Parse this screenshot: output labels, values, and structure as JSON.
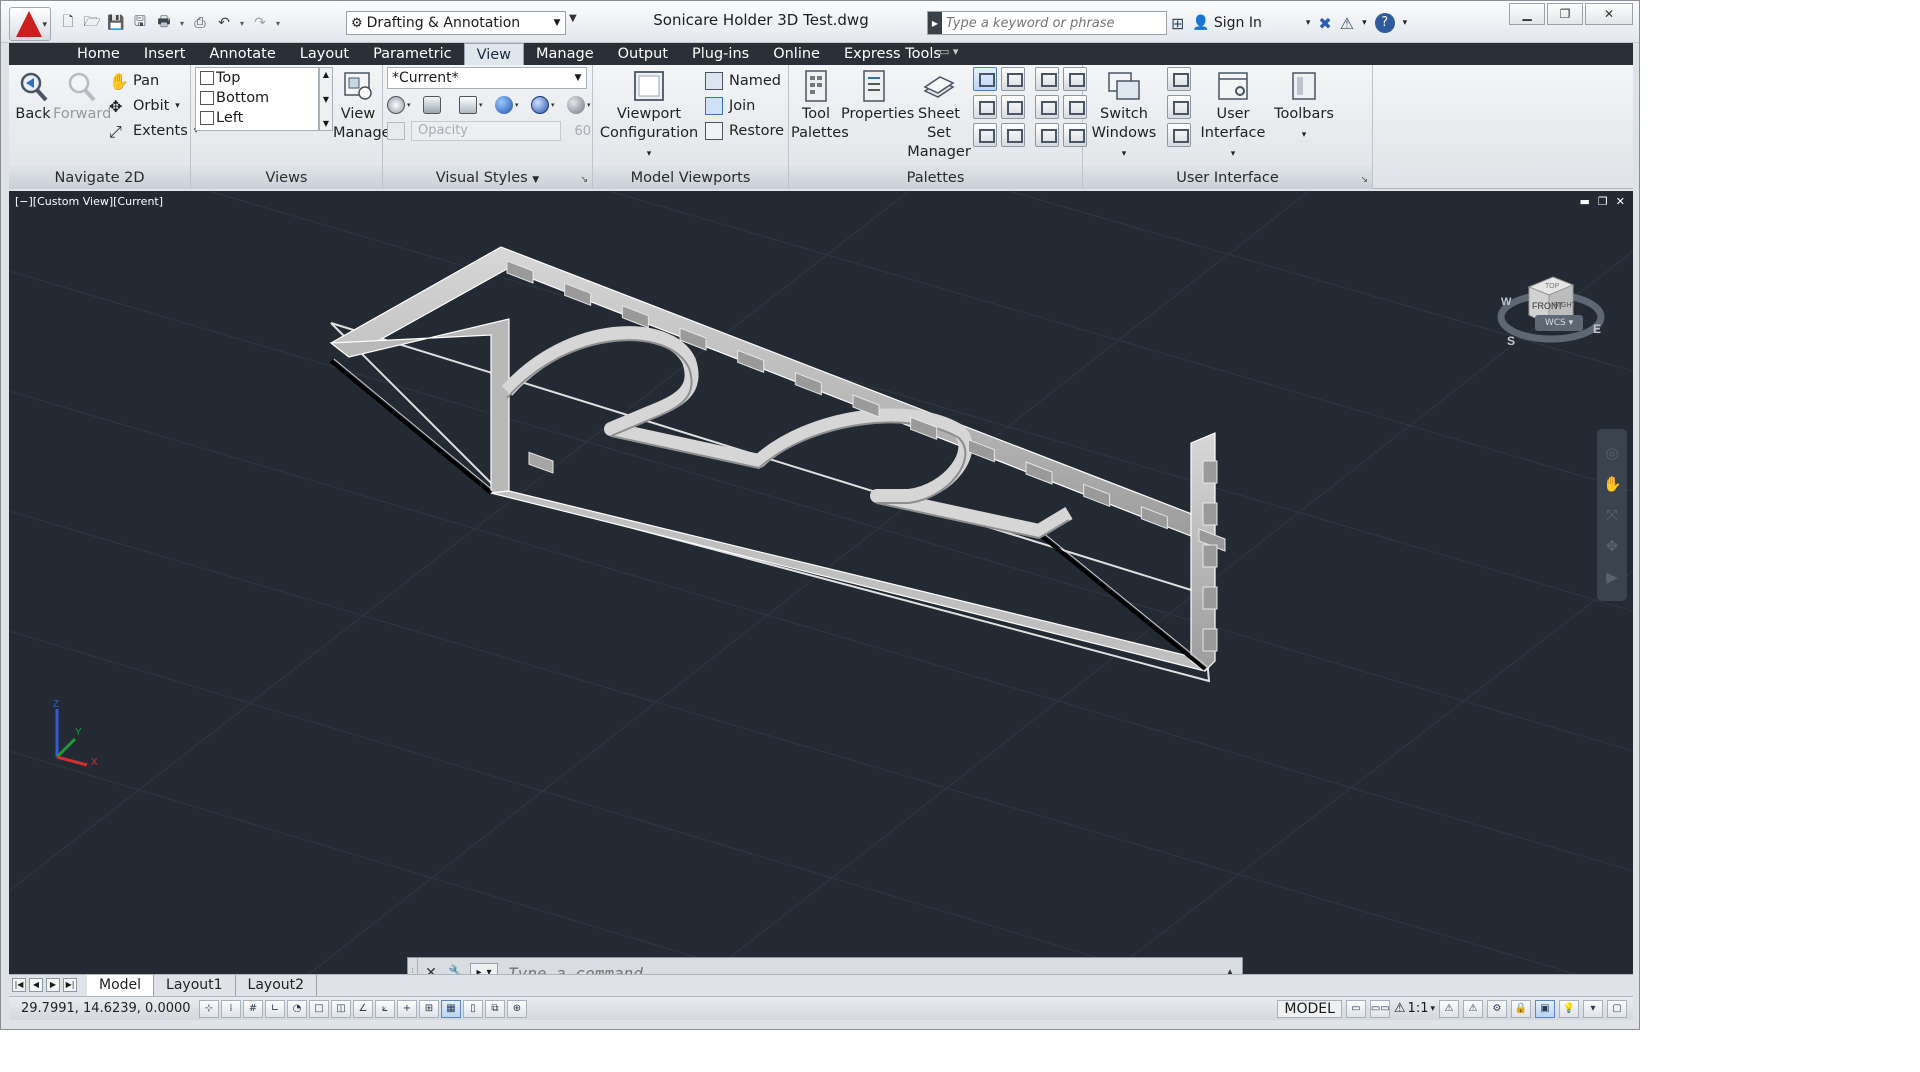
{
  "titlebar": {
    "document_title": "Sonicare Holder 3D Test.dwg",
    "workspace": "Drafting & Annotation",
    "search_placeholder": "Type a keyword or phrase",
    "sign_in": "Sign In"
  },
  "tabs": [
    "Home",
    "Insert",
    "Annotate",
    "Layout",
    "Parametric",
    "View",
    "Manage",
    "Output",
    "Plug-ins",
    "Online",
    "Express Tools"
  ],
  "active_tab": "View",
  "ribbon": {
    "navigate2d": {
      "title": "Navigate 2D",
      "back": "Back",
      "forward": "Forward",
      "pan": "Pan",
      "orbit": "Orbit",
      "extents": "Extents"
    },
    "views": {
      "title": "Views",
      "items": [
        "Top",
        "Bottom",
        "Left"
      ],
      "view_manager_line1": "View",
      "view_manager_line2": "Manager"
    },
    "visual_styles": {
      "title": "Visual Styles",
      "current": "*Current*",
      "opacity_label": "Opacity",
      "opacity_value": "60"
    },
    "model_viewports": {
      "title": "Model Viewports",
      "config_line1": "Viewport",
      "config_line2": "Configuration",
      "named": "Named",
      "join": "Join",
      "restore": "Restore"
    },
    "palettes": {
      "title": "Palettes",
      "tool_line1": "Tool",
      "tool_line2": "Palettes",
      "properties": "Properties",
      "sheetset_line1": "Sheet Set",
      "sheetset_line2": "Manager"
    },
    "user_interface": {
      "title": "User Interface",
      "switch_line1": "Switch",
      "switch_line2": "Windows",
      "ui_line1": "User",
      "ui_line2": "Interface",
      "toolbars": "Toolbars"
    }
  },
  "viewport": {
    "label": "[−][Custom View][Current]",
    "viewcube_front": "FRONT",
    "viewcube_right": "RIGHT",
    "viewcube_top": "TOP",
    "compass_s": "S",
    "compass_e": "E",
    "compass_w": "W",
    "wcs": "WCS",
    "axis_x": "X",
    "axis_y": "Y",
    "axis_z": "Z"
  },
  "command": {
    "placeholder": "Type a command"
  },
  "layouts": [
    "Model",
    "Layout1",
    "Layout2"
  ],
  "active_layout": "Model",
  "status": {
    "coordinates": "29.7991, 14.6239, 0.0000",
    "model": "MODEL",
    "scale": "1:1"
  },
  "colors": {
    "viewport_bg": "#232a34",
    "ribbon_tab_bar": "#2a3038",
    "logo_red": "#cc1e1e"
  }
}
